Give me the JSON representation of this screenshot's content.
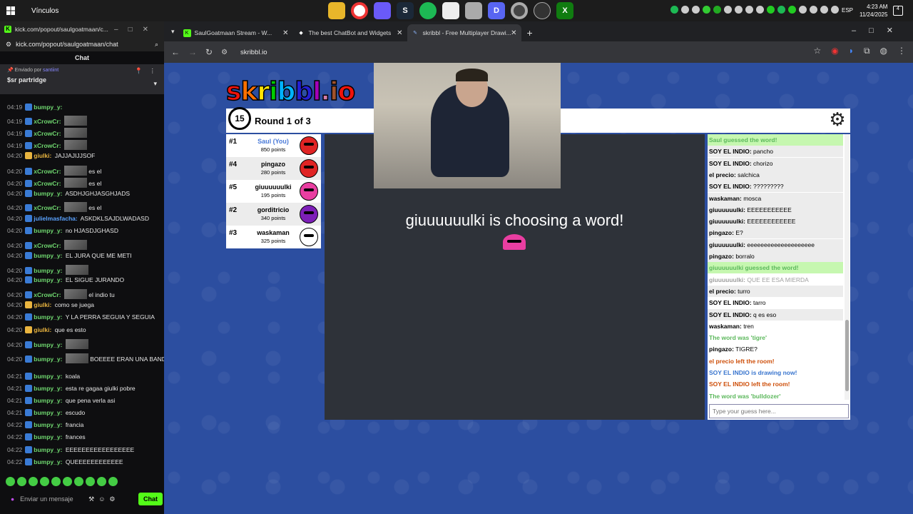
{
  "taskbar": {
    "vinculos": "Vínculos",
    "lang": "ESP",
    "time": "4:23 AM",
    "date": "11/24/2025",
    "notif": "4"
  },
  "kick": {
    "window_title": "kick.com/popout/saulgoatmaan/c...",
    "url": "kick.com/popout/saulgoatmaan/chat",
    "chat_title": "Chat",
    "pinned_by": "Enviado por",
    "pinned_user": "santiint",
    "pinned_msg": "$sr partridge",
    "input_placeholder": "Enviar un mensaje",
    "chat_button": "Chat",
    "messages": [
      {
        "t": "04:19",
        "n": "bumpy_y:",
        "c": "#6fd76f",
        "txt": ""
      },
      {
        "t": "04:19",
        "n": "xCrowCr:",
        "c": "#6fd76f",
        "txt": "",
        "emote": true
      },
      {
        "t": "04:19",
        "n": "xCrowCr:",
        "c": "#6fd76f",
        "txt": "",
        "emote": true
      },
      {
        "t": "04:19",
        "n": "xCrowCr:",
        "c": "#6fd76f",
        "txt": "",
        "emote": true
      },
      {
        "t": "04:20",
        "n": "giulki:",
        "c": "#e9b43f",
        "txt": "JAJJAJIJJSOF"
      },
      {
        "t": "04:20",
        "n": "xCrowCr:",
        "c": "#6fd76f",
        "txt": "es el",
        "emote": true
      },
      {
        "t": "04:20",
        "n": "xCrowCr:",
        "c": "#6fd76f",
        "txt": "es el",
        "emote": true
      },
      {
        "t": "04:20",
        "n": "bumpy_y:",
        "c": "#6fd76f",
        "txt": "ASDHJGHJASGHJADS"
      },
      {
        "t": "04:20",
        "n": "xCrowCr:",
        "c": "#6fd76f",
        "txt": "es el",
        "emote": true
      },
      {
        "t": "04:20",
        "n": "julielmasfacha:",
        "c": "#5aa2ff",
        "txt": "ASKDKLSAJDLWADASD"
      },
      {
        "t": "04:20",
        "n": "bumpy_y:",
        "c": "#6fd76f",
        "txt": "no HJASDJGHASD"
      },
      {
        "t": "04:20",
        "n": "xCrowCr:",
        "c": "#6fd76f",
        "txt": "",
        "emote": true
      },
      {
        "t": "04:20",
        "n": "bumpy_y:",
        "c": "#6fd76f",
        "txt": "EL JURA QUE ME METI"
      },
      {
        "t": "04:20",
        "n": "bumpy_y:",
        "c": "#6fd76f",
        "txt": "",
        "emote": true
      },
      {
        "t": "04:20",
        "n": "bumpy_y:",
        "c": "#6fd76f",
        "txt": "EL SIGUE JURANDO"
      },
      {
        "t": "04:20",
        "n": "xCrowCr:",
        "c": "#6fd76f",
        "txt": "el indio tu",
        "emote": true
      },
      {
        "t": "04:20",
        "n": "giulki:",
        "c": "#e9b43f",
        "txt": "como se juega"
      },
      {
        "t": "04:20",
        "n": "bumpy_y:",
        "c": "#6fd76f",
        "txt": "Y LA PERRA SEGUIA Y SEGUIA"
      },
      {
        "t": "04:20",
        "n": "giulki:",
        "c": "#e9b43f",
        "txt": "que es esto"
      },
      {
        "t": "04:20",
        "n": "bumpy_y:",
        "c": "#6fd76f",
        "txt": "",
        "emote": true
      },
      {
        "t": "04:20",
        "n": "bumpy_y:",
        "c": "#6fd76f",
        "txt": "BOEEEE ERAN UNA BANDA",
        "emote": true
      },
      {
        "t": "04:21",
        "n": "bumpy_y:",
        "c": "#6fd76f",
        "txt": "koala"
      },
      {
        "t": "04:21",
        "n": "bumpy_y:",
        "c": "#6fd76f",
        "txt": "esta re gagaa giulki pobre"
      },
      {
        "t": "04:21",
        "n": "bumpy_y:",
        "c": "#6fd76f",
        "txt": "que pena verla asi"
      },
      {
        "t": "04:21",
        "n": "bumpy_y:",
        "c": "#6fd76f",
        "txt": "escudo"
      },
      {
        "t": "04:22",
        "n": "bumpy_y:",
        "c": "#6fd76f",
        "txt": "francia"
      },
      {
        "t": "04:22",
        "n": "bumpy_y:",
        "c": "#6fd76f",
        "txt": "frances"
      },
      {
        "t": "04:22",
        "n": "bumpy_y:",
        "c": "#6fd76f",
        "txt": "EEEEEEEEEEEEEEEEE"
      },
      {
        "t": "04:22",
        "n": "bumpy_y:",
        "c": "#6fd76f",
        "txt": "QUEEEEEEEEEEEE"
      }
    ]
  },
  "browser": {
    "tabs": [
      {
        "label": "SaulGoatmaan Stream - W...",
        "fav": "K",
        "favcolor": "#53fc18"
      },
      {
        "label": "The best ChatBot and Widgets",
        "fav": "◆",
        "favcolor": "#ffffff"
      },
      {
        "label": "skribbl - Free Multiplayer Drawi...",
        "fav": "✎",
        "favcolor": "#8ab4f8"
      }
    ],
    "url": "skribbl.io"
  },
  "game": {
    "logo": "skribbl.io",
    "timer": "15",
    "round": "Round 1 of 3",
    "choosing": "giuuuuuulki is choosing a word!",
    "guess_placeholder": "Type your guess here...",
    "players": [
      {
        "rank": "#1",
        "name": "Saul (You)",
        "points": "850 points",
        "color": "#e02424",
        "you": true
      },
      {
        "rank": "#4",
        "name": "pingazo",
        "points": "280 points",
        "color": "#e02424"
      },
      {
        "rank": "#5",
        "name": "giuuuuuulki",
        "points": "195 points",
        "color": "#e93ea1"
      },
      {
        "rank": "#2",
        "name": "gorditricio",
        "points": "340 points",
        "color": "#7d1fb8"
      },
      {
        "rank": "#3",
        "name": "waskaman",
        "points": "325 points",
        "color": "#ffffff"
      }
    ],
    "chat": [
      {
        "type": "green bg",
        "who": "",
        "txt": "Saul guessed the word!"
      },
      {
        "type": "",
        "who": "SOY EL INDIO:",
        "txt": "pancho"
      },
      {
        "type": "alt",
        "who": "SOY EL INDIO:",
        "txt": "chorizo"
      },
      {
        "type": "",
        "who": "el precio:",
        "txt": "salchica"
      },
      {
        "type": "alt",
        "who": "SOY EL INDIO:",
        "txt": "?????????"
      },
      {
        "type": "",
        "who": "waskaman:",
        "txt": "mosca"
      },
      {
        "type": "alt",
        "who": "giuuuuuulki:",
        "txt": "EEEEEEEEEEE"
      },
      {
        "type": "",
        "who": "giuuuuuulki:",
        "txt": "EEEEEEEEEEEE"
      },
      {
        "type": "alt",
        "who": "pingazo:",
        "txt": "E?"
      },
      {
        "type": "",
        "who": "giuuuuuulki:",
        "txt": "eeeeeeeeeeeeeeeeeeee"
      },
      {
        "type": "alt",
        "who": "pingazo:",
        "txt": "borralo"
      },
      {
        "type": "green bg",
        "who": "",
        "txt": "giuuuuuulki guessed the word!"
      },
      {
        "type": "gray",
        "who": "giuuuuuulki:",
        "txt": "QUE EE ESA MIERDA"
      },
      {
        "type": "alt",
        "who": "el precio:",
        "txt": "turro"
      },
      {
        "type": "",
        "who": "SOY EL INDIO:",
        "txt": "tarro"
      },
      {
        "type": "alt",
        "who": "SOY EL INDIO:",
        "txt": "q es eso"
      },
      {
        "type": "",
        "who": "waskaman:",
        "txt": "tren"
      },
      {
        "type": "green",
        "who": "",
        "txt": "The word was 'tigre'"
      },
      {
        "type": "",
        "who": "pingazo:",
        "txt": "TIGRE?"
      },
      {
        "type": "orange",
        "who": "",
        "txt": "el precio left the room!"
      },
      {
        "type": "blue",
        "who": "",
        "txt": "SOY EL INDIO is drawing now!"
      },
      {
        "type": "orange",
        "who": "",
        "txt": "SOY EL INDIO left the room!"
      },
      {
        "type": "green",
        "who": "",
        "txt": "The word was 'bulldozer'"
      }
    ]
  }
}
